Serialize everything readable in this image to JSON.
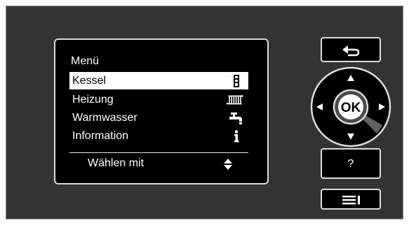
{
  "menu": {
    "title": "Menü",
    "items": [
      {
        "label": "Kessel",
        "icon": "boiler-icon",
        "selected": true
      },
      {
        "label": "Heizung",
        "icon": "radiator-icon",
        "selected": false
      },
      {
        "label": "Warmwasser",
        "icon": "faucet-icon",
        "selected": false
      },
      {
        "label": "Information",
        "icon": "info-icon",
        "selected": false
      }
    ],
    "footer_label": "Wählen mit",
    "footer_icon": "up-down-arrows-icon"
  },
  "controls": {
    "back_icon": "back-arrow-icon",
    "ok_label": "OK",
    "help_label": "?",
    "menu_icon": "menu-icon"
  },
  "colors": {
    "panel": "#333333",
    "screen": "#000000",
    "highlight": "#ffffff"
  }
}
